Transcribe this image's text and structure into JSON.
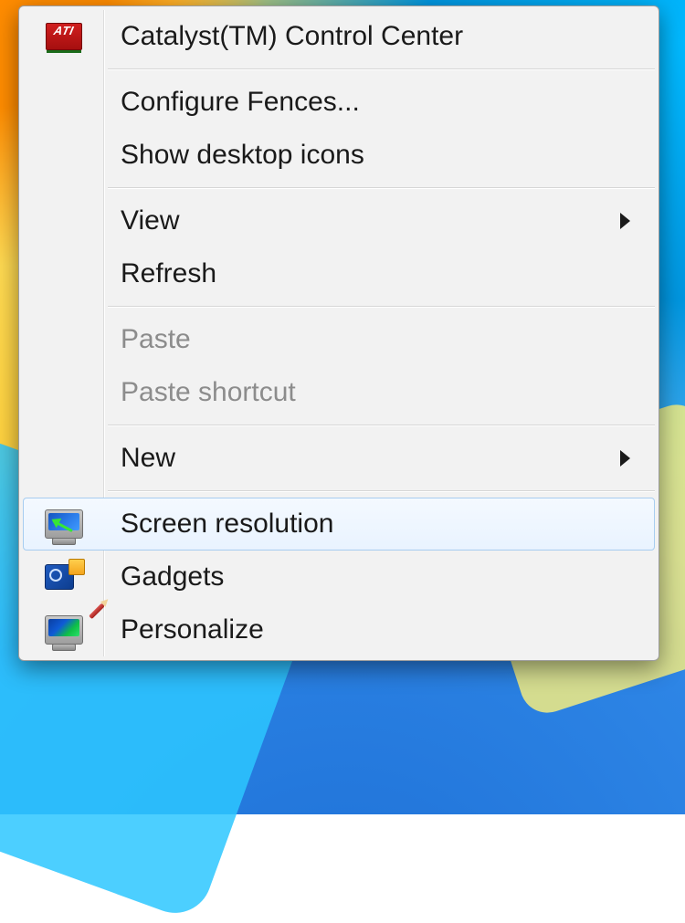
{
  "menu": {
    "items": {
      "catalyst": {
        "label": "Catalyst(TM) Control Center"
      },
      "configure_fences": {
        "label": "Configure Fences..."
      },
      "show_icons": {
        "label": "Show desktop icons"
      },
      "view": {
        "label": "View"
      },
      "refresh": {
        "label": "Refresh"
      },
      "paste": {
        "label": "Paste"
      },
      "paste_shortcut": {
        "label": "Paste shortcut"
      },
      "new": {
        "label": "New"
      },
      "screen_res": {
        "label": "Screen resolution"
      },
      "gadgets": {
        "label": "Gadgets"
      },
      "personalize": {
        "label": "Personalize"
      }
    }
  }
}
